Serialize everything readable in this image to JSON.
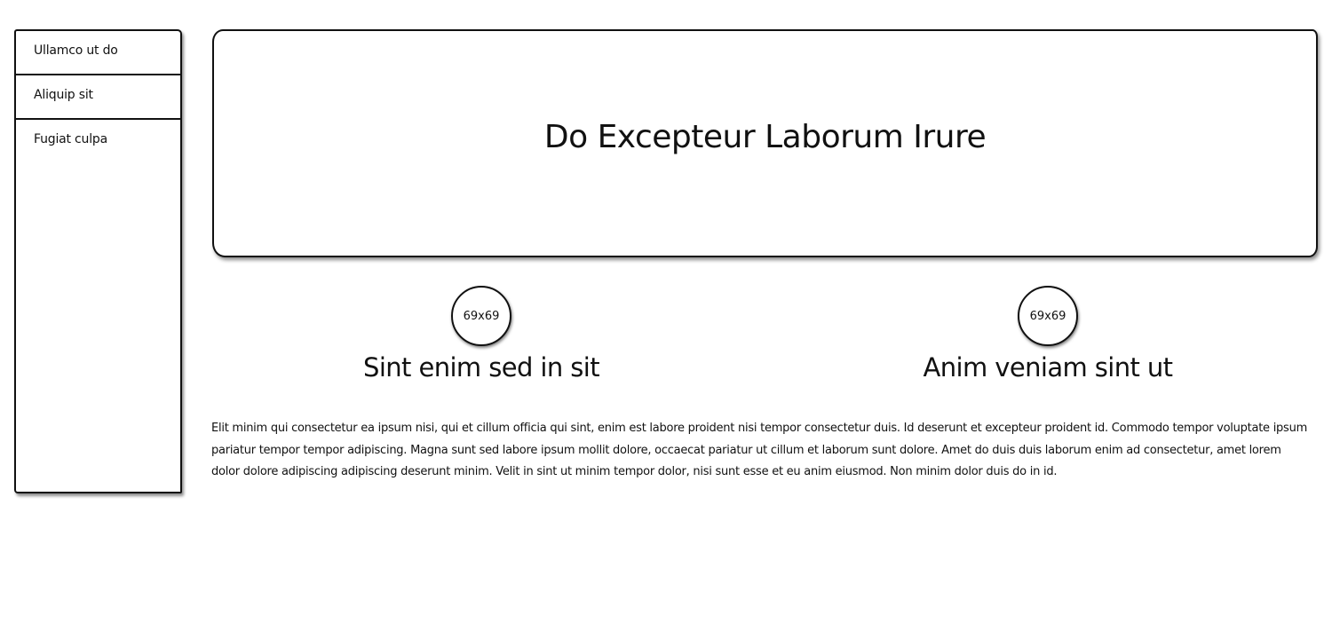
{
  "sidebar": {
    "items": [
      {
        "label": "Ullamco ut do"
      },
      {
        "label": "Aliquip sit"
      },
      {
        "label": "Fugiat culpa"
      }
    ]
  },
  "hero": {
    "title": "Do Excepteur Laborum Irure"
  },
  "features": [
    {
      "image_label": "69x69",
      "title": "Sint enim sed in sit"
    },
    {
      "image_label": "69x69",
      "title": "Anim veniam sint ut"
    }
  ],
  "body": {
    "text": "Elit minim qui consectetur ea ipsum nisi, qui et cillum officia qui sint, enim est labore proident nisi tempor consectetur duis. Id deserunt et excepteur proident id. Commodo tempor voluptate ipsum pariatur tempor tempor adipiscing. Magna sunt sed labore ipsum mollit dolore, occaecat pariatur ut cillum et laborum sunt dolore. Amet do duis duis laborum enim ad consectetur, amet lorem dolor dolore adipiscing adipiscing deserunt minim. Velit in sint ut minim tempor dolor, nisi sunt esse et eu anim eiusmod. Non minim dolor duis do in id."
  }
}
